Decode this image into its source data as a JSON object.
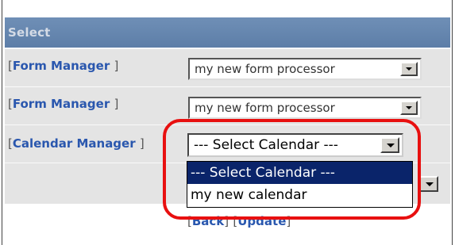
{
  "header": {
    "title": "Select"
  },
  "rows": [
    {
      "label": "Form Manager",
      "selected": "my new form processor"
    },
    {
      "label": "Form Manager",
      "selected": "my new form processor"
    },
    {
      "label": "Calendar Manager",
      "selected": "--- Select Calendar ---"
    }
  ],
  "dropdown": {
    "options": [
      "--- Select Calendar ---",
      "my new calendar"
    ],
    "highlighted_index": 0
  },
  "links": {
    "back": "Back",
    "update": "Update"
  },
  "brackets": {
    "open": "[",
    "close": "]"
  },
  "colors": {
    "header_bg": "#5d7ea8",
    "link": "#2a57ae",
    "highlight_ring": "#e81010",
    "selected_option_bg": "#0a246a"
  }
}
